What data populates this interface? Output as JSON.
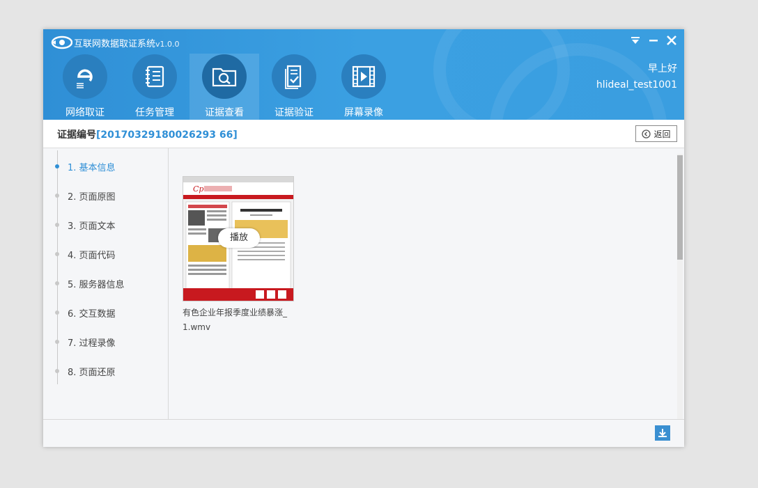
{
  "app": {
    "title": "互联网数据取证系统",
    "version": "v1.0.0",
    "logo_icon": "eye-logo-icon",
    "controls": {
      "menu_icon": "menu-down-icon",
      "minimize_icon": "minimize-icon",
      "close_icon": "close-icon"
    }
  },
  "nav": {
    "items": [
      {
        "label": "网络取证",
        "icon": "e-browser-icon"
      },
      {
        "label": "任务管理",
        "icon": "notebook-icon"
      },
      {
        "label": "证据查看",
        "icon": "folder-search-icon",
        "active": true
      },
      {
        "label": "证据验证",
        "icon": "document-check-icon"
      },
      {
        "label": "屏幕录像",
        "icon": "film-play-icon"
      }
    ]
  },
  "user": {
    "greeting": "早上好",
    "username": "hlideal_test1001"
  },
  "evidence": {
    "id_label": "证据编号",
    "id_value": "[20170329180026293 66]",
    "back_label": "返回"
  },
  "sidebar": {
    "steps": [
      {
        "label": "1. 基本信息",
        "active": true
      },
      {
        "label": "2. 页面原图"
      },
      {
        "label": "3. 页面文本"
      },
      {
        "label": "4. 页面代码"
      },
      {
        "label": "5. 服务器信息"
      },
      {
        "label": "6. 交互数据"
      },
      {
        "label": "7. 过程录像"
      },
      {
        "label": "8. 页面还原"
      }
    ]
  },
  "content": {
    "video": {
      "play_label": "播放",
      "filename": "有色企业年报季度业绩暴涨_1.wmv"
    }
  },
  "footer": {
    "download_icon": "download-icon"
  },
  "colors": {
    "accent": "#2f8fd6",
    "header_bg": "#3a9ee0",
    "thumb_red": "#c8191f"
  }
}
